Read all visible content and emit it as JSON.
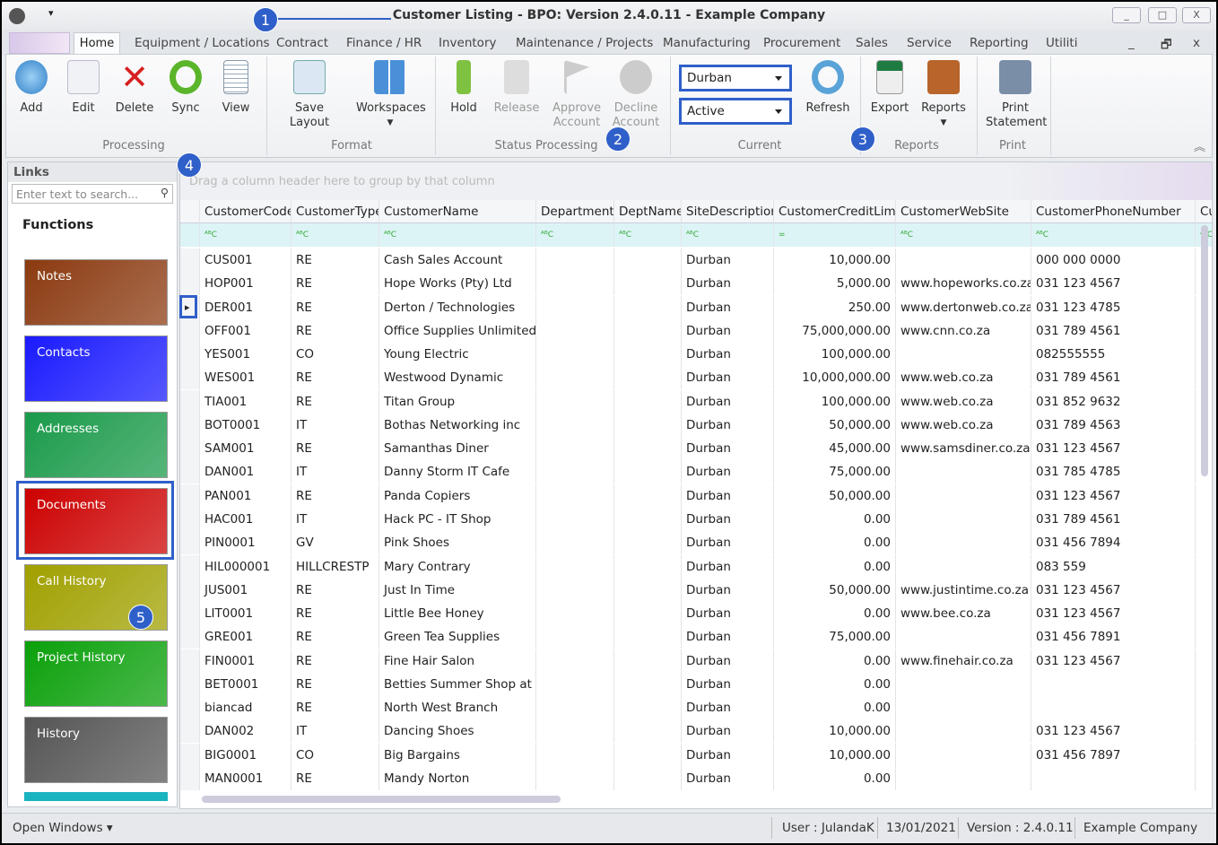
{
  "window": {
    "title": "Customer Listing - BPO: Version 2.4.0.11 - Example Company"
  },
  "tabs": [
    "Home",
    "Equipment / Locations",
    "Contract",
    "Finance / HR",
    "Inventory",
    "Maintenance / Projects",
    "Manufacturing",
    "Procurement",
    "Sales",
    "Service",
    "Reporting",
    "Utiliti"
  ],
  "ribbon": {
    "processing": {
      "label": "Processing",
      "buttons": [
        "Add",
        "Edit",
        "Delete",
        "Sync",
        "View"
      ]
    },
    "format": {
      "label": "Format",
      "buttons": [
        "Save Layout",
        "Workspaces"
      ]
    },
    "status_processing": {
      "label": "Status Processing",
      "buttons": [
        "Hold",
        "Release",
        "Approve Account",
        "Decline Account"
      ]
    },
    "current": {
      "label": "Current",
      "site": "Durban",
      "status": "Active",
      "refresh": "Refresh"
    },
    "reports": {
      "label": "Reports",
      "buttons": [
        "Export",
        "Reports"
      ]
    },
    "print": {
      "label": "Print",
      "buttons": [
        "Print Statement"
      ]
    }
  },
  "annotations": [
    "1",
    "2",
    "3",
    "4",
    "5"
  ],
  "links": {
    "title": "Links",
    "search_placeholder": "Enter text to search...",
    "functions": "Functions",
    "tiles": [
      {
        "label": "Notes",
        "color": "#8b3a10"
      },
      {
        "label": "Contacts",
        "color": "#1a1aff"
      },
      {
        "label": "Addresses",
        "color": "#1a9a4a"
      },
      {
        "label": "Documents",
        "color": "#cc0000"
      },
      {
        "label": "Call History",
        "color": "#a0a000"
      },
      {
        "label": "Project History",
        "color": "#0aa00a"
      },
      {
        "label": "History",
        "color": "#555555"
      }
    ]
  },
  "grid": {
    "group_hint": "Drag a column header here to group by that column",
    "columns": [
      "CustomerCode",
      "CustomerType",
      "CustomerName",
      "Department",
      "DeptName",
      "SiteDescription",
      "CustomerCreditLimit",
      "CustomerWebSite",
      "CustomerPhoneNumber",
      "Cu"
    ],
    "rows": [
      [
        "CUS001",
        "RE",
        "Cash Sales Account",
        "",
        "",
        "Durban",
        "10,000.00",
        "",
        "000 000 0000"
      ],
      [
        "HOP001",
        "RE",
        "Hope Works (Pty) Ltd",
        "",
        "",
        "Durban",
        "5,000.00",
        "www.hopeworks.co.za",
        "031 123 4567"
      ],
      [
        "DER001",
        "RE",
        "Derton / Technologies",
        "",
        "",
        "Durban",
        "250.00",
        "www.dertonweb.co.za",
        "031 123 4785"
      ],
      [
        "OFF001",
        "RE",
        "Office Supplies Unlimited",
        "",
        "",
        "Durban",
        "75,000,000.00",
        "www.cnn.co.za",
        "031 789 4561"
      ],
      [
        "YES001",
        "CO",
        "Young Electric",
        "",
        "",
        "Durban",
        "100,000.00",
        "",
        "082555555"
      ],
      [
        "WES001",
        "RE",
        "Westwood Dynamic",
        "",
        "",
        "Durban",
        "10,000,000.00",
        "www.web.co.za",
        "031 789 4561"
      ],
      [
        "TIA001",
        "RE",
        "Titan Group",
        "",
        "",
        "Durban",
        "100,000.00",
        "www.web.co.za",
        "031 852 9632"
      ],
      [
        "BOT0001",
        "IT",
        "Bothas Networking inc",
        "",
        "",
        "Durban",
        "50,000.00",
        "www.web.co.za",
        "031 789 4563"
      ],
      [
        "SAM001",
        "RE",
        "Samanthas Diner",
        "",
        "",
        "Durban",
        "45,000.00",
        "www.samsdiner.co.za",
        "031 123 4567"
      ],
      [
        "DAN001",
        "IT",
        "Danny Storm IT Cafe",
        "",
        "",
        "Durban",
        "75,000.00",
        "",
        "031 785 4785"
      ],
      [
        "PAN001",
        "RE",
        "Panda Copiers",
        "",
        "",
        "Durban",
        "50,000.00",
        "",
        "031 123 4567"
      ],
      [
        "HAC001",
        "IT",
        "Hack PC - IT Shop",
        "",
        "",
        "Durban",
        "0.00",
        "",
        "031 789 4561"
      ],
      [
        "PIN0001",
        "GV",
        "Pink Shoes",
        "",
        "",
        "Durban",
        "0.00",
        "",
        "031 456 7894"
      ],
      [
        "HIL000001",
        "HILLCRESTP",
        "Mary Contrary",
        "",
        "",
        "Durban",
        "0.00",
        "",
        "083 559"
      ],
      [
        "JUS001",
        "RE",
        "Just In Time",
        "",
        "",
        "Durban",
        "50,000.00",
        "www.justintime.co.za",
        "031 123 4567"
      ],
      [
        "LIT0001",
        "RE",
        "Little Bee Honey",
        "",
        "",
        "Durban",
        "0.00",
        "www.bee.co.za",
        "031 123 4567"
      ],
      [
        "GRE001",
        "RE",
        "Green Tea Supplies",
        "",
        "",
        "Durban",
        "75,000.00",
        "",
        "031 456 7891"
      ],
      [
        "FIN0001",
        "RE",
        "Fine Hair Salon",
        "",
        "",
        "Durban",
        "0.00",
        "www.finehair.co.za",
        "031 123 4567"
      ],
      [
        "BET0001",
        "RE",
        "Betties Summer Shop at t...",
        "",
        "",
        "Durban",
        "0.00",
        "",
        ""
      ],
      [
        "biancad",
        "RE",
        "North West Branch",
        "",
        "",
        "Durban",
        "0.00",
        "",
        ""
      ],
      [
        "DAN002",
        "IT",
        "Dancing Shoes",
        "",
        "",
        "Durban",
        "10,000.00",
        "",
        "031 123 4567"
      ],
      [
        "BIG0001",
        "CO",
        "Big Bargains",
        "",
        "",
        "Durban",
        "10,000.00",
        "",
        "031 456 7897"
      ],
      [
        "MAN0001",
        "RE",
        "Mandy Norton",
        "",
        "",
        "Durban",
        "0.00",
        "",
        ""
      ]
    ]
  },
  "status": {
    "open_windows": "Open Windows ▾",
    "user": "User : JulandaK",
    "date": "13/01/2021",
    "version": "Version : 2.4.0.11",
    "company": "Example Company"
  }
}
